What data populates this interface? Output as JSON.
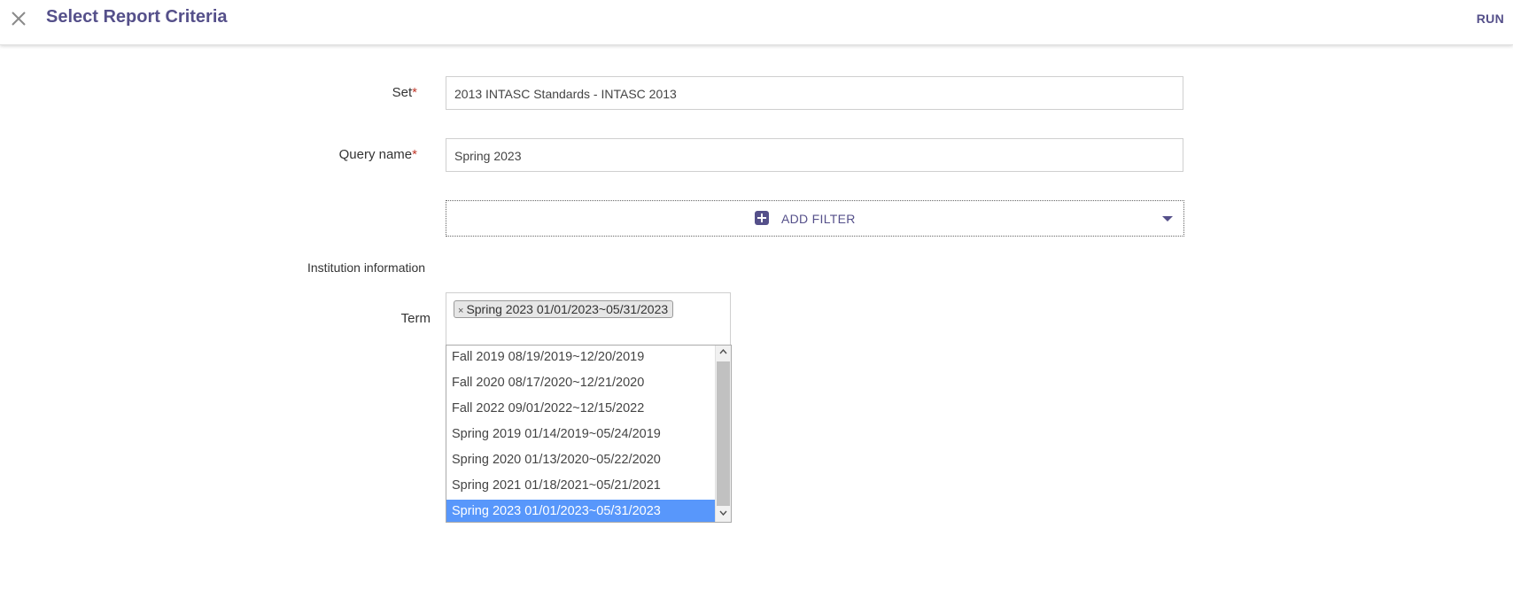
{
  "header": {
    "title": "Select Report Criteria",
    "run_label": "RUN",
    "close_icon": "close-icon",
    "accent_color": "#55508a"
  },
  "form": {
    "set": {
      "label": "Set",
      "required_mark": "*",
      "value": "2013 INTASC Standards - INTASC 2013"
    },
    "query_name": {
      "label": "Query name",
      "required_mark": "*",
      "value": "Spring 2023"
    },
    "add_filter": {
      "label": "ADD FILTER",
      "icon": "plus-square-icon",
      "dropdown_icon": "caret-down-icon"
    },
    "institution_section_label": "Institution information",
    "term": {
      "label": "Term",
      "selected_chips": [
        "Spring 2023 01/01/2023~05/31/2023"
      ],
      "options": [
        "Fall 2019 08/19/2019~12/20/2019",
        "Fall 2020 08/17/2020~12/21/2020",
        "Fall 2022 09/01/2022~12/15/2022",
        "Spring 2019 01/14/2019~05/24/2019",
        "Spring 2020 01/13/2020~05/22/2020",
        "Spring 2021 01/18/2021~05/21/2021",
        "Spring 2023 01/01/2023~05/31/2023"
      ],
      "highlighted_option": "Spring 2023 01/01/2023~05/31/2023",
      "highlight_color": "#5897fb"
    }
  }
}
